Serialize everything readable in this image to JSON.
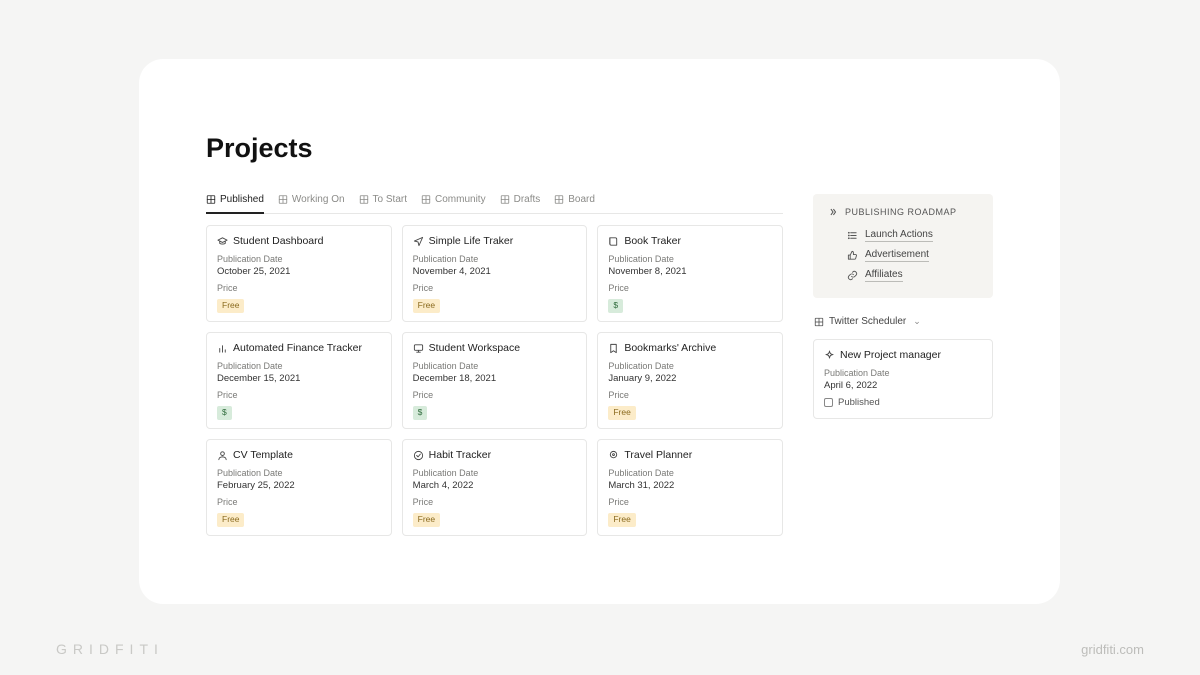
{
  "page": {
    "title": "Projects"
  },
  "tabs": [
    {
      "label": "Published",
      "active": true
    },
    {
      "label": "Working On",
      "active": false
    },
    {
      "label": "To Start",
      "active": false
    },
    {
      "label": "Community",
      "active": false
    },
    {
      "label": "Drafts",
      "active": false
    },
    {
      "label": "Board",
      "active": false
    }
  ],
  "labels": {
    "publication_date": "Publication Date",
    "price": "Price"
  },
  "cards": [
    {
      "icon": "graduation-cap",
      "title": "Student Dashboard",
      "date": "October 25, 2021",
      "price_type": "free",
      "price_text": "Free"
    },
    {
      "icon": "paper-plane",
      "title": "Simple Life Traker",
      "date": "November 4, 2021",
      "price_type": "free",
      "price_text": "Free"
    },
    {
      "icon": "book",
      "title": "Book Traker",
      "date": "November 8, 2021",
      "price_type": "dollar",
      "price_text": "$"
    },
    {
      "icon": "bar-chart",
      "title": "Automated Finance Tracker",
      "date": "December 15, 2021",
      "price_type": "dollar",
      "price_text": "$"
    },
    {
      "icon": "monitor",
      "title": "Student Workspace",
      "date": "December 18, 2021",
      "price_type": "dollar",
      "price_text": "$"
    },
    {
      "icon": "bookmark",
      "title": "Bookmarks' Archive",
      "date": "January 9, 2022",
      "price_type": "free",
      "price_text": "Free"
    },
    {
      "icon": "user",
      "title": "CV Template",
      "date": "February 25, 2022",
      "price_type": "free",
      "price_text": "Free"
    },
    {
      "icon": "check-circle",
      "title": "Habit Tracker",
      "date": "March 4, 2022",
      "price_type": "free",
      "price_text": "Free"
    },
    {
      "icon": "pin",
      "title": "Travel Planner",
      "date": "March 31, 2022",
      "price_type": "free",
      "price_text": "Free"
    }
  ],
  "roadmap": {
    "title": "PUBLISHING ROADMAP",
    "items": [
      {
        "icon": "list",
        "label": "Launch Actions"
      },
      {
        "icon": "thumbs-up",
        "label": "Advertisement"
      },
      {
        "icon": "link",
        "label": "Affiliates"
      }
    ]
  },
  "twitter_toggle": {
    "label": "Twitter Scheduler"
  },
  "sidecard": {
    "title": "New Project manager",
    "date": "April 6, 2022",
    "status": "Published"
  },
  "footer": {
    "brand": "GRIDFITI",
    "url": "gridfiti.com"
  }
}
